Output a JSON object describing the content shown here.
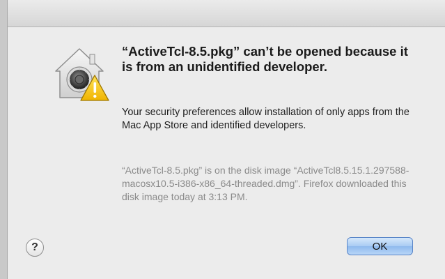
{
  "dialog": {
    "heading": "“ActiveTcl-8.5.pkg” can’t be opened because it is from an unidentified developer.",
    "body": "Your security preferences allow installation of only apps from the Mac App Store and identified developers.",
    "detail": "“ActiveTcl-8.5.pkg” is on the disk image “ActiveTcl8.5.15.1.297588-macosx10.5-i386-x86_64-threaded.dmg”. Firefox downloaded this disk image today at 3:13 PM.",
    "help_label": "?",
    "ok_label": "OK",
    "icon": "gatekeeper-warning-icon"
  },
  "colors": {
    "ok_accent": "#a9cbf3",
    "warning": "#f5c400"
  }
}
